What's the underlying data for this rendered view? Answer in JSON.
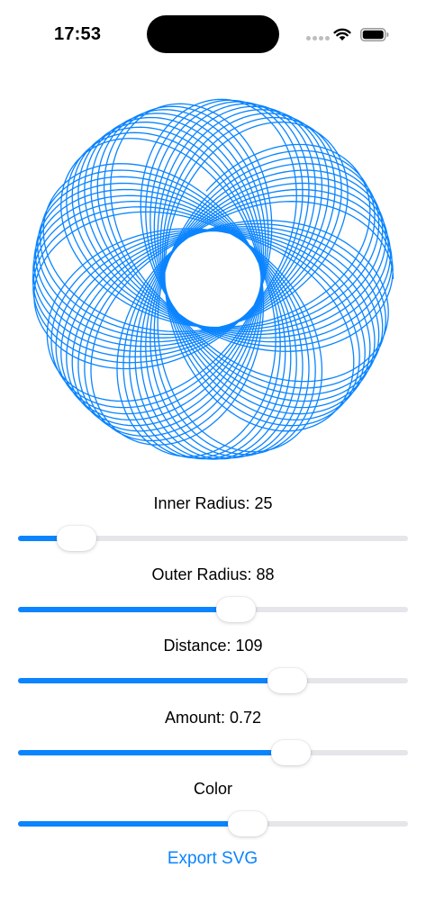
{
  "status_bar": {
    "time": "17:53"
  },
  "spirograph": {
    "inner_radius": 25,
    "outer_radius": 88,
    "distance": 109,
    "amount": 0.72,
    "color": "#0a84ff"
  },
  "controls": [
    {
      "label": "Inner Radius: 25",
      "value_fraction": 0.15
    },
    {
      "label": "Outer Radius: 88",
      "value_fraction": 0.56
    },
    {
      "label": "Distance: 109",
      "value_fraction": 0.69
    },
    {
      "label": "Amount: 0.72",
      "value_fraction": 0.7
    },
    {
      "label": "Color",
      "value_fraction": 0.59
    }
  ],
  "export_button": {
    "label": "Export SVG"
  },
  "colors": {
    "accent": "#0a84ff",
    "track": "#e5e5ea"
  }
}
